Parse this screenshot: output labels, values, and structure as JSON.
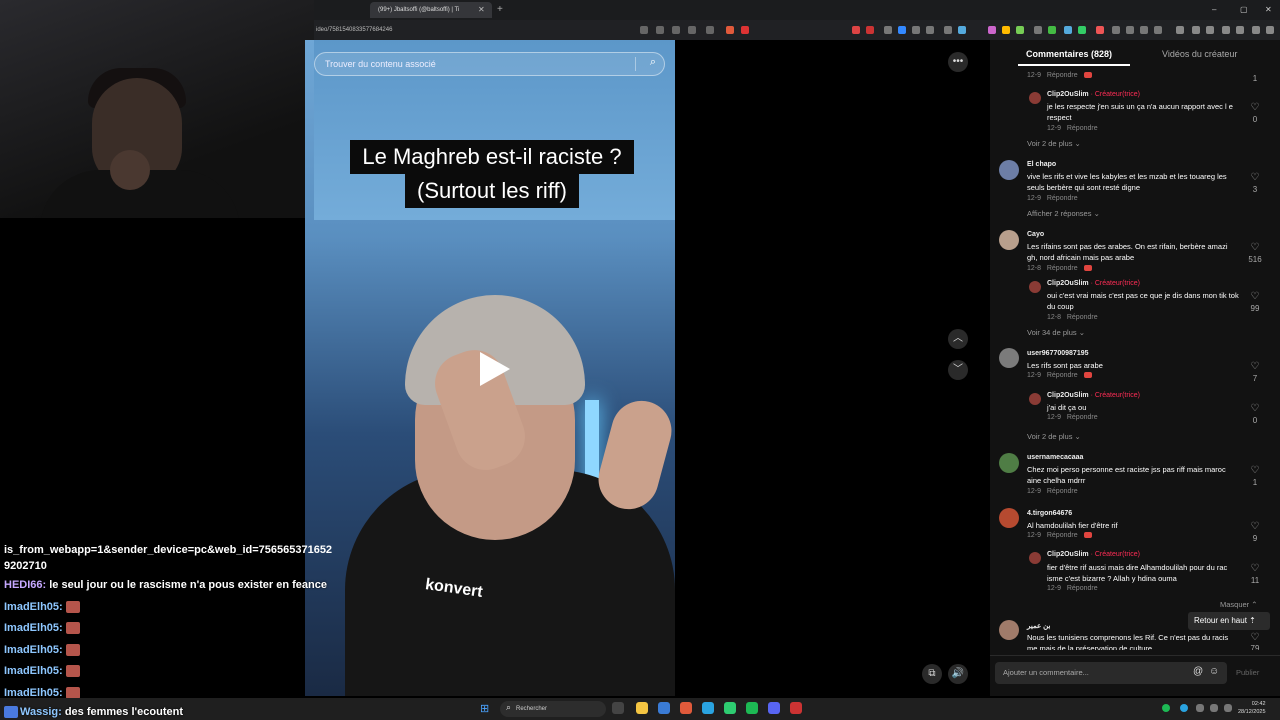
{
  "browser": {
    "tab_title": "(99+) Jbaltsoffi (@baltsoffi) | Ti",
    "url": "ideo/7581540833577684246",
    "window_controls": [
      "–",
      "▢",
      "✕"
    ]
  },
  "video": {
    "search_placeholder": "Trouver du contenu associé",
    "title_line1": "Le Maghreb est-il raciste ?",
    "title_line2": "(Surtout les riff)",
    "shirt_text": "konvert",
    "more_label": "•••"
  },
  "chat": {
    "url_line1": "is_from_webapp=1&sender_device=pc&web_id=756565371652",
    "url_line2": "9202710",
    "messages": [
      {
        "user": "HEDI66:",
        "text": "le seul jour ou le rascisme n'a pous exister en feance"
      },
      {
        "user": "ImadElh05:",
        "text": ""
      },
      {
        "user": "ImadElh05:",
        "text": ""
      },
      {
        "user": "ImadElh05:",
        "text": ""
      },
      {
        "user": "ImadElh05:",
        "text": ""
      },
      {
        "user": "ImadElh05:",
        "text": ""
      }
    ],
    "ticker_user": "Wassig:",
    "ticker_text": "des femmes l'ecoutent"
  },
  "panel": {
    "tab_comments": "Commentaires (828)",
    "tab_videos": "Vidéos du créateur",
    "reply_label": "Répondre",
    "creator_tag": "· Créateur(trice)",
    "top_partial": {
      "date": "12-9",
      "likes": "1"
    },
    "comments": [
      {
        "id": "c1",
        "user": "Clip2OuSlim",
        "creator": true,
        "text": "je les respecte j'en suis un ça n'a aucun rapport avec l e respect",
        "date": "12-9",
        "likes": "0",
        "more": "Voir 2 de plus"
      },
      {
        "id": "c2",
        "user": "El chapo",
        "text": "vive les rifs et vive les kabyles et les mzab et les touareg les seuls berbère qui sont resté digne",
        "date": "12-9",
        "likes": "3",
        "more": "Afficher 2 réponses"
      },
      {
        "id": "c3",
        "user": "Cayo",
        "text": "Les rifains sont pas des arabes. On est rifain, berbère amazi gh, nord africain mais pas arabe",
        "date": "12-8",
        "likes": "516"
      },
      {
        "id": "c4",
        "user": "Clip2OuSlim",
        "creator": true,
        "text": "oui c'est vrai mais c'est pas ce que je dis dans mon tik tok du coup",
        "date": "12-8",
        "likes": "99",
        "more": "Voir 34 de plus"
      },
      {
        "id": "c5",
        "user": "user967700987195",
        "text": "Les rifs sont pas arabe",
        "date": "12-9",
        "likes": "7"
      },
      {
        "id": "c6",
        "user": "Clip2OuSlim",
        "creator": true,
        "text": "j'ai dit ça ou",
        "date": "12-9",
        "likes": "0",
        "more": "Voir 2 de plus"
      },
      {
        "id": "c7",
        "user": "usernamecacaaa",
        "text": "Chez moi perso personne est raciste jss pas riff mais maroc aine chelha mdrrr",
        "date": "12-9",
        "likes": "1"
      },
      {
        "id": "c8",
        "user": "4.tirgon64676",
        "text": "Al hamdoulilah fier d'être rif",
        "date": "12-9",
        "likes": "9"
      },
      {
        "id": "c9",
        "user": "Clip2OuSlim",
        "creator": true,
        "text": "fier d'être rif aussi mais dire Alhamdoulilah pour du rac isme c'est bizarre ? Allah y hdina ouma",
        "date": "12-9",
        "likes": "11",
        "more": "Masquer"
      },
      {
        "id": "c10",
        "user": "بن عمير",
        "text": "Nous les tunisiens comprenons les Rif. Ce n'est pas du racis me mais de la préservation de culture",
        "likes": "79"
      }
    ],
    "back_to_top": "Retour en haut",
    "add_comment_placeholder": "Ajouter un commentaire...",
    "publish": "Publier"
  },
  "taskbar": {
    "search_placeholder": "Rechercher",
    "time": "02:42",
    "date": "28/12/2025"
  },
  "colors": {
    "accent": "#fe2c55",
    "panel_bg": "#121212",
    "chat_user": "#8ec7ff",
    "chat_user_hedi": "#c6a8ff"
  }
}
